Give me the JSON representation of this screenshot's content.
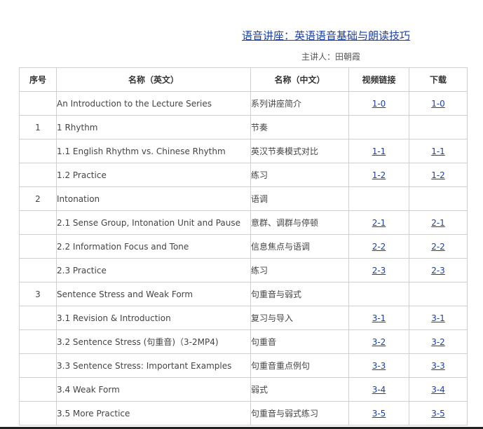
{
  "page": {
    "title": "语音讲座：英语语音基础与朗读技巧",
    "speaker": "主讲人：田朝霞"
  },
  "table": {
    "headers": {
      "num": "序号",
      "name_en": "名称（英文）",
      "name_zh": "名称（中文）",
      "video": "视频链接",
      "download": "下载"
    },
    "rows": [
      {
        "num": "",
        "en": "An Introduction to the Lecture Series",
        "zh": "系列讲座简介",
        "video": "1-0",
        "download": "1-0"
      },
      {
        "num": "1",
        "en": "1 Rhythm",
        "zh": "节奏",
        "video": "",
        "download": ""
      },
      {
        "num": "",
        "en": "1.1 English Rhythm vs. Chinese Rhythm",
        "zh": "英汉节奏模式对比",
        "video": "1-1",
        "download": "1-1"
      },
      {
        "num": "",
        "en": "1.2 Practice",
        "zh": "练习",
        "video": "1-2",
        "download": "1-2"
      },
      {
        "num": "2",
        "en": "Intonation",
        "zh": "语调",
        "video": "",
        "download": ""
      },
      {
        "num": "",
        "en": "2.1 Sense Group, Intonation Unit and Pause",
        "zh": "意群、调群与停顿",
        "video": "2-1",
        "download": "2-1"
      },
      {
        "num": "",
        "en": "2.2 Information Focus and Tone",
        "zh": "信息焦点与语调",
        "video": "2-2",
        "download": "2-2"
      },
      {
        "num": "",
        "en": "2.3 Practice",
        "zh": "练习",
        "video": "2-3",
        "download": "2-3"
      },
      {
        "num": "3",
        "en": "Sentence Stress and Weak Form",
        "zh": "句重音与弱式",
        "video": "",
        "download": ""
      },
      {
        "num": "",
        "en": "3.1 Revision & Introduction",
        "zh": "复习与导入",
        "video": "3-1",
        "download": "3-1"
      },
      {
        "num": "",
        "en": "3.2 Sentence Stress (句重音)（3-2MP4)",
        "zh": "句重音",
        "video": "3-2",
        "download": "3-2"
      },
      {
        "num": "",
        "en": "3.3 Sentence Stress: Important Examples",
        "zh": "句重音重点例句",
        "video": "3-3",
        "download": "3-3"
      },
      {
        "num": "",
        "en": "3.4 Weak Form",
        "zh": "弱式",
        "video": "3-4",
        "download": "3-4"
      },
      {
        "num": "",
        "en": "3.5 More Practice",
        "zh": "句重音与弱式练习",
        "video": "3-5",
        "download": "3-5"
      }
    ]
  },
  "colors": {
    "link": "#1a3fa8",
    "border": "#cfcfcf",
    "text": "#444444"
  }
}
